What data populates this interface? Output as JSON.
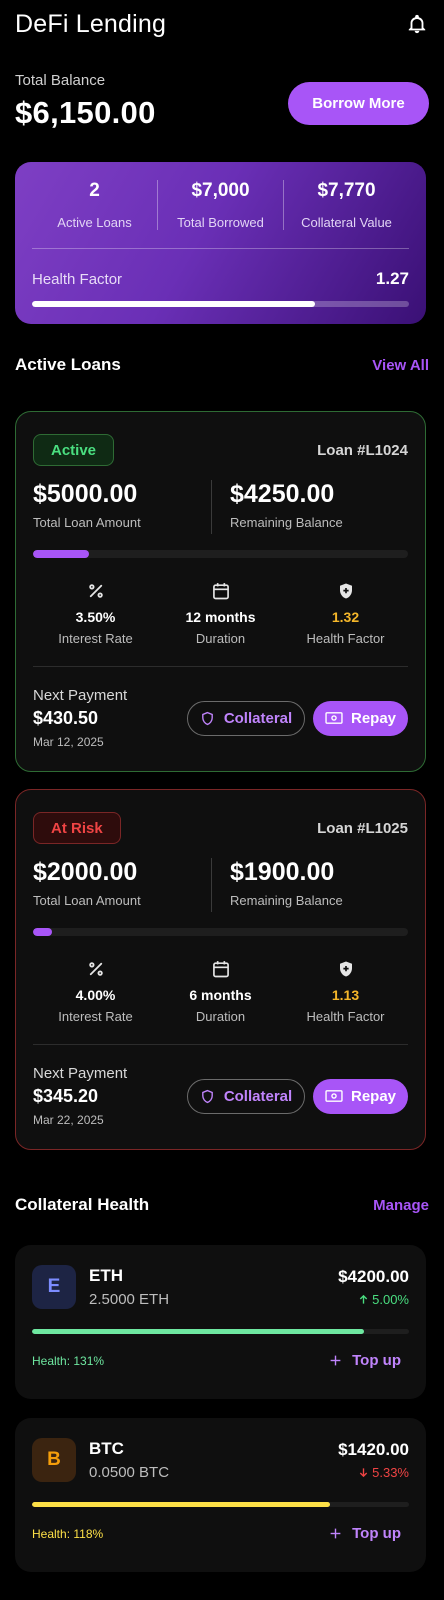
{
  "header": {
    "title": "DeFi Lending",
    "icon": "bell-icon"
  },
  "balance": {
    "label": "Total Balance",
    "value": "$6,150.00",
    "borrow_label": "Borrow More"
  },
  "summary": {
    "stats": [
      {
        "value": "2",
        "label": "Active Loans"
      },
      {
        "value": "$7,000",
        "label": "Total Borrowed"
      },
      {
        "value": "$7,770",
        "label": "Collateral Value"
      }
    ],
    "health_label": "Health Factor",
    "health_value": "1.27",
    "health_progress": 0.75
  },
  "active_loans": {
    "title": "Active Loans",
    "link": "View All",
    "loans": [
      {
        "status": "Active",
        "id": "Loan #L1024",
        "total_amount": "$5000.00",
        "total_label": "Total Loan Amount",
        "remaining": "$4250.00",
        "remaining_label": "Remaining Balance",
        "repaid_progress": 0.15,
        "metrics": [
          {
            "icon": "percent-icon",
            "value": "3.50%",
            "label": "Interest Rate"
          },
          {
            "icon": "calendar-icon",
            "value": "12 months",
            "label": "Duration"
          },
          {
            "icon": "shield-plus-icon",
            "value": "1.32",
            "label": "Health Factor"
          }
        ],
        "next_payment_label": "Next Payment",
        "next_payment_amount": "$430.50",
        "next_payment_date": "Mar 12, 2025",
        "collateral_label": "Collateral",
        "repay_label": "Repay"
      },
      {
        "status": "At Risk",
        "id": "Loan #L1025",
        "total_amount": "$2000.00",
        "total_label": "Total Loan Amount",
        "remaining": "$1900.00",
        "remaining_label": "Remaining Balance",
        "repaid_progress": 0.05,
        "metrics": [
          {
            "icon": "percent-icon",
            "value": "4.00%",
            "label": "Interest Rate"
          },
          {
            "icon": "calendar-icon",
            "value": "6 months",
            "label": "Duration"
          },
          {
            "icon": "shield-plus-icon",
            "value": "1.13",
            "label": "Health Factor"
          }
        ],
        "next_payment_label": "Next Payment",
        "next_payment_amount": "$345.20",
        "next_payment_date": "Mar 22, 2025",
        "collateral_label": "Collateral",
        "repay_label": "Repay"
      }
    ]
  },
  "collateral": {
    "title": "Collateral Health",
    "link": "Manage",
    "assets": [
      {
        "letter": "E",
        "symbol": "ETH",
        "amount": "2.5000 ETH",
        "usd": "$4200.00",
        "change": "5.00%",
        "direction": "up",
        "health_progress": 0.88,
        "health": "Health: 131%",
        "topup_label": "Top up"
      },
      {
        "letter": "B",
        "symbol": "BTC",
        "amount": "0.0500 BTC",
        "usd": "$1420.00",
        "change": "5.33%",
        "direction": "down",
        "health_progress": 0.79,
        "health": "Health: 118%",
        "topup_label": "Top up"
      }
    ]
  },
  "colors": {
    "accent": "#a855f7",
    "success": "#4ade80",
    "danger": "#ef4444",
    "warning": "#f5b72a"
  }
}
